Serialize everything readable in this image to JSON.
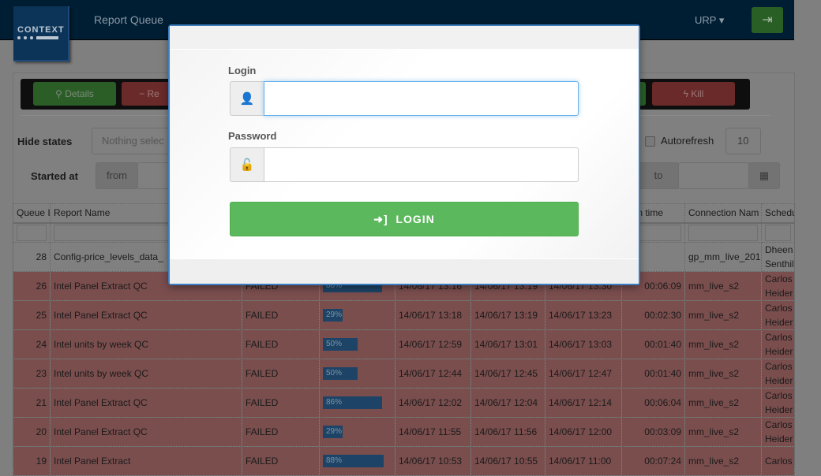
{
  "nav": {
    "logo_text": "CONTEXT",
    "title": "Report Queue",
    "user": "URP",
    "signin_icon": "sign-in-icon"
  },
  "toolbar": {
    "details": "Details",
    "remove": "Re",
    "kill": "Kill"
  },
  "filters": {
    "hide_states_label": "Hide states",
    "hide_states_placeholder": "Nothing selec",
    "autorefresh_label": "Autorefresh",
    "autorefresh_value": "10",
    "started_at_label": "Started at",
    "from": "from",
    "to": "to"
  },
  "table": {
    "headers": [
      "Queue I",
      "Report Name",
      "",
      "",
      "",
      "",
      "",
      "Run time",
      "Connection Nam",
      "Schedu"
    ],
    "rows": [
      {
        "id": "28",
        "name": "Config-price_levels_data_",
        "state": "",
        "progress": null,
        "p_label": "",
        "t1": "",
        "t2": "",
        "t3": "",
        "run": "",
        "conn": "gp_mm_live_201",
        "sched": "Dheen Senthil",
        "status": "gray"
      },
      {
        "id": "26",
        "name": "Intel Panel Extract QC",
        "state": "FAILED",
        "progress": 86,
        "p_label": "86%",
        "t1": "14/06/17 13:16",
        "t2": "14/06/17 13:19",
        "t3": "14/06/17 13:30",
        "run": "00:06:09",
        "conn": "mm_live_s2",
        "sched": "Carlos Heider",
        "status": "fail"
      },
      {
        "id": "25",
        "name": "Intel Panel Extract QC",
        "state": "FAILED",
        "progress": 29,
        "p_label": "29%",
        "t1": "14/06/17 13:18",
        "t2": "14/06/17 13:19",
        "t3": "14/06/17 13:23",
        "run": "00:02:30",
        "conn": "mm_live_s2",
        "sched": "Carlos Heider",
        "status": "fail"
      },
      {
        "id": "24",
        "name": "Intel units by week QC",
        "state": "FAILED",
        "progress": 50,
        "p_label": "50%",
        "t1": "14/06/17 12:59",
        "t2": "14/06/17 13:01",
        "t3": "14/06/17 13:03",
        "run": "00:01:40",
        "conn": "mm_live_s2",
        "sched": "Carlos Heider",
        "status": "fail"
      },
      {
        "id": "23",
        "name": "Intel units by week QC",
        "state": "FAILED",
        "progress": 50,
        "p_label": "50%",
        "t1": "14/06/17 12:44",
        "t2": "14/06/17 12:45",
        "t3": "14/06/17 12:47",
        "run": "00:01:40",
        "conn": "mm_live_s2",
        "sched": "Carlos Heider",
        "status": "fail"
      },
      {
        "id": "21",
        "name": "Intel Panel Extract QC",
        "state": "FAILED",
        "progress": 86,
        "p_label": "86%",
        "t1": "14/06/17 12:02",
        "t2": "14/06/17 12:04",
        "t3": "14/06/17 12:14",
        "run": "00:06:04",
        "conn": "mm_live_s2",
        "sched": "Carlos Heider",
        "status": "fail"
      },
      {
        "id": "20",
        "name": "Intel Panel Extract QC",
        "state": "FAILED",
        "progress": 29,
        "p_label": "29%",
        "t1": "14/06/17 11:55",
        "t2": "14/06/17 11:56",
        "t3": "14/06/17 12:00",
        "run": "00:03:09",
        "conn": "mm_live_s2",
        "sched": "Carlos Heider",
        "status": "fail"
      },
      {
        "id": "19",
        "name": "Intel Panel Extract",
        "state": "FAILED",
        "progress": 88,
        "p_label": "88%",
        "t1": "14/06/17 10:53",
        "t2": "14/06/17 10:55",
        "t3": "14/06/17 11:00",
        "run": "00:07:24",
        "conn": "mm_live_s2",
        "sched": "Carlos",
        "status": "fail"
      }
    ]
  },
  "modal": {
    "login_label": "Login",
    "login_value": "",
    "password_label": "Password",
    "password_value": "",
    "login_button": "LOGIN"
  }
}
